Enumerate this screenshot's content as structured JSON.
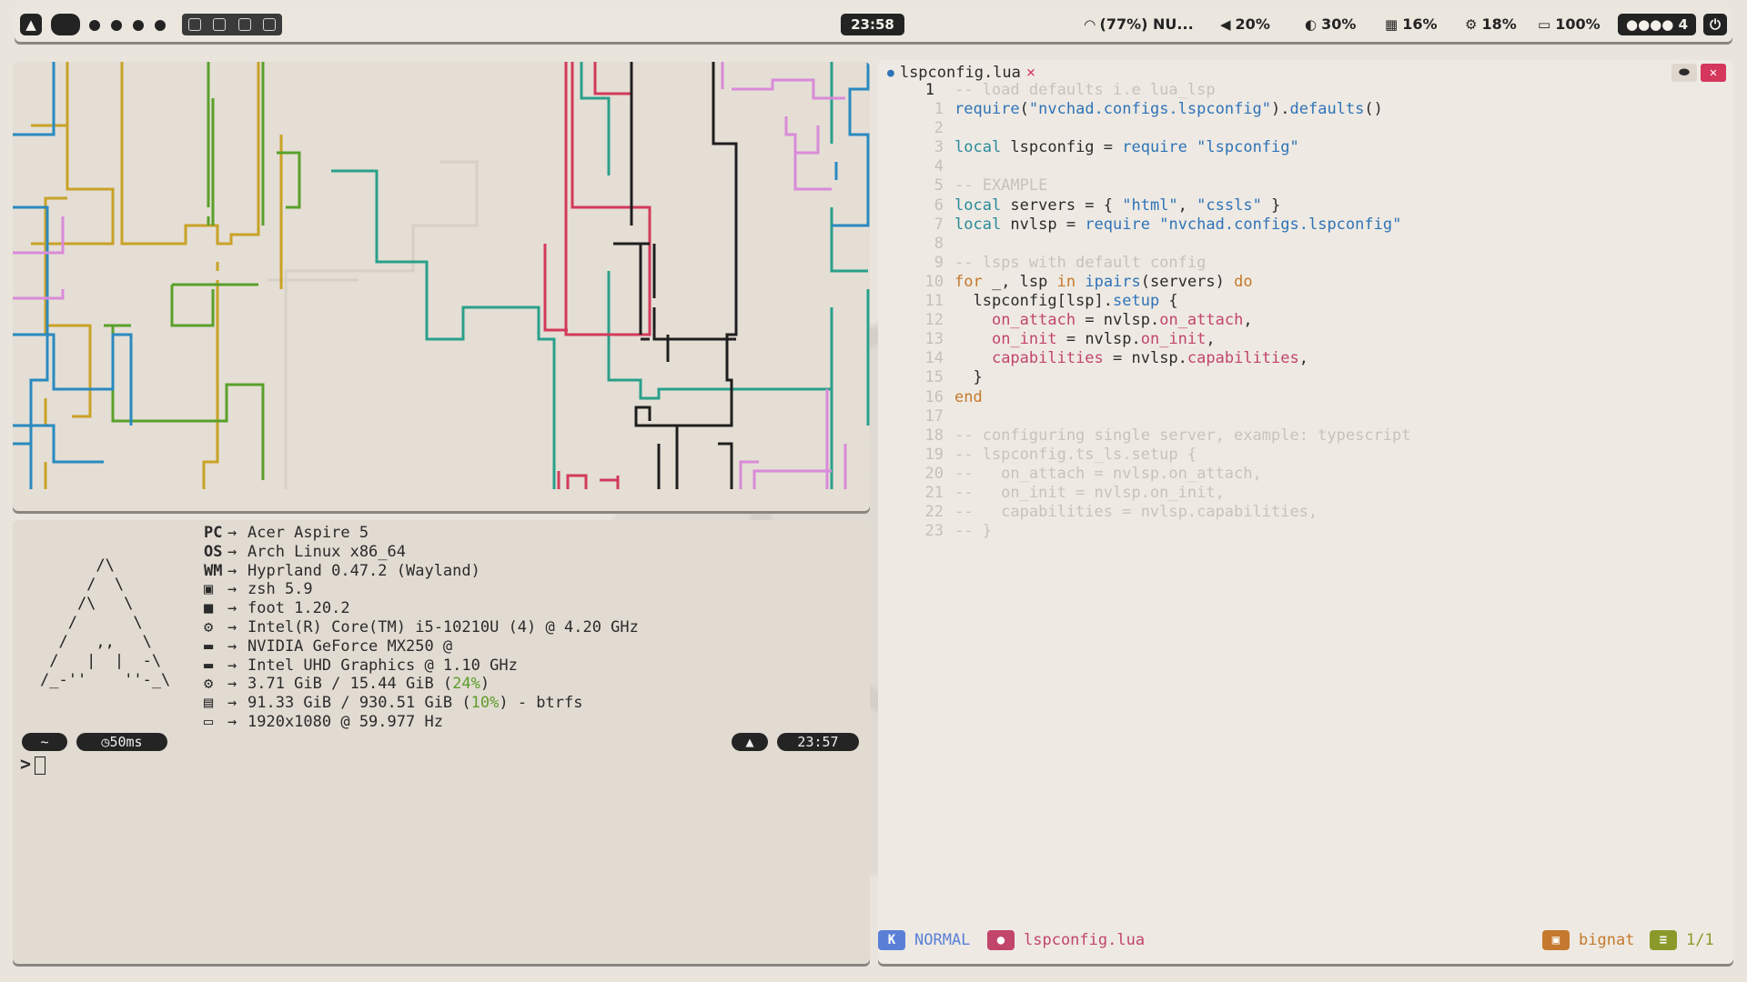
{
  "topbar": {
    "clock": "23:58",
    "wifi": "(77%) NU...",
    "volume": "20%",
    "brightness": "30%",
    "memory": "16%",
    "cpu": "18%",
    "battery": "100%",
    "notifications": "4",
    "icons": [
      "arch-logo",
      "wifi-icon",
      "volume-icon",
      "brightness-icon",
      "memory-icon",
      "cpu-icon",
      "battery-icon",
      "power-icon"
    ]
  },
  "fetch": {
    "logo": "      /\\\n     /  \\\n    /\\   \\\n   /      \\\n  /   ,,   \\\n /   |  |  -\\\n/_-''    ''-_\\",
    "rows": [
      {
        "key": "PC",
        "value": "Acer Aspire 5"
      },
      {
        "key": "OS",
        "value": "Arch Linux x86_64"
      },
      {
        "key": "WM",
        "value": "Hyprland 0.47.2 (Wayland)"
      },
      {
        "key": "",
        "value": "zsh 5.9"
      },
      {
        "key": "",
        "value": "foot 1.20.2"
      },
      {
        "key": "",
        "value": "Intel(R) Core(TM) i5-10210U (4) @ 4.20 GHz"
      },
      {
        "key": "",
        "value": "NVIDIA GeForce MX250 @"
      },
      {
        "key": "",
        "value": "Intel UHD Graphics @ 1.10 GHz"
      },
      {
        "key": "",
        "value_a": "3.71 GiB / 15.44 GiB (",
        "value_pct": "24%",
        "value_b": ")"
      },
      {
        "key": "",
        "value_a": "91.33 GiB / 930.51 GiB (",
        "value_pct": "10%",
        "value_b": ") - btrfs"
      },
      {
        "key": "",
        "value": "1920x1080 @ 59.977 Hz"
      }
    ],
    "arrow": "→",
    "prompt_dir": "~",
    "prompt_time": "50ms",
    "prompt_clock": "23:57",
    "prompt_symbol": ">"
  },
  "editor": {
    "filename": "lspconfig.lua",
    "close": "×",
    "status_mode": "NORMAL",
    "status_file": "lspconfig.lua",
    "status_branch": "bignat",
    "status_pos": "1/1",
    "lines": [
      {
        "n": "1",
        "cur": true,
        "parts": [
          [
            "cm",
            "-- load defaults i.e lua_lsp"
          ]
        ]
      },
      {
        "n": "1",
        "parts": [
          [
            "fn",
            "require"
          ],
          [
            "src",
            "("
          ],
          [
            "st",
            "\"nvchad.configs.lspconfig\""
          ],
          [
            "src",
            ")."
          ],
          [
            "fn",
            "defaults"
          ],
          [
            "src",
            "()"
          ]
        ]
      },
      {
        "n": "2",
        "parts": []
      },
      {
        "n": "3",
        "parts": [
          [
            "kw",
            "local"
          ],
          [
            "src",
            " lspconfig = "
          ],
          [
            "fn",
            "require"
          ],
          [
            "src",
            " "
          ],
          [
            "st",
            "\"lspconfig\""
          ]
        ]
      },
      {
        "n": "4",
        "parts": []
      },
      {
        "n": "5",
        "parts": [
          [
            "cm",
            "-- EXAMPLE"
          ]
        ]
      },
      {
        "n": "6",
        "parts": [
          [
            "kw",
            "local"
          ],
          [
            "src",
            " servers = { "
          ],
          [
            "st",
            "\"html\""
          ],
          [
            "src",
            ", "
          ],
          [
            "st",
            "\"cssls\""
          ],
          [
            "src",
            " }"
          ]
        ]
      },
      {
        "n": "7",
        "parts": [
          [
            "kw",
            "local"
          ],
          [
            "src",
            " nvlsp = "
          ],
          [
            "fn",
            "require"
          ],
          [
            "src",
            " "
          ],
          [
            "st",
            "\"nvchad.configs.lspconfig\""
          ]
        ]
      },
      {
        "n": "8",
        "parts": []
      },
      {
        "n": "9",
        "parts": [
          [
            "cm",
            "-- lsps with default config"
          ]
        ]
      },
      {
        "n": "10",
        "parts": [
          [
            "ctrl",
            "for"
          ],
          [
            "src",
            " _, lsp "
          ],
          [
            "ctrl",
            "in"
          ],
          [
            "src",
            " "
          ],
          [
            "fn",
            "ipairs"
          ],
          [
            "src",
            "(servers) "
          ],
          [
            "ctrl",
            "do"
          ]
        ]
      },
      {
        "n": "11",
        "parts": [
          [
            "src",
            "  lspconfig[lsp]."
          ],
          [
            "fn",
            "setup"
          ],
          [
            "src",
            " {"
          ]
        ]
      },
      {
        "n": "12",
        "parts": [
          [
            "src",
            "    "
          ],
          [
            "fld",
            "on_attach"
          ],
          [
            "src",
            " = nvlsp."
          ],
          [
            "fld",
            "on_attach"
          ],
          [
            "src",
            ","
          ]
        ]
      },
      {
        "n": "13",
        "parts": [
          [
            "src",
            "    "
          ],
          [
            "fld",
            "on_init"
          ],
          [
            "src",
            " = nvlsp."
          ],
          [
            "fld",
            "on_init"
          ],
          [
            "src",
            ","
          ]
        ]
      },
      {
        "n": "14",
        "parts": [
          [
            "src",
            "    "
          ],
          [
            "fld",
            "capabilities"
          ],
          [
            "src",
            " = nvlsp."
          ],
          [
            "fld",
            "capabilities"
          ],
          [
            "src",
            ","
          ]
        ]
      },
      {
        "n": "15",
        "parts": [
          [
            "src",
            "  }"
          ]
        ]
      },
      {
        "n": "16",
        "parts": [
          [
            "ctrl",
            "end"
          ]
        ]
      },
      {
        "n": "17",
        "parts": []
      },
      {
        "n": "18",
        "parts": [
          [
            "cm",
            "-- configuring single server, example: typescript"
          ]
        ]
      },
      {
        "n": "19",
        "parts": [
          [
            "cm",
            "-- lspconfig.ts_ls.setup {"
          ]
        ]
      },
      {
        "n": "20",
        "parts": [
          [
            "cm",
            "--   on_attach = nvlsp.on_attach,"
          ]
        ]
      },
      {
        "n": "21",
        "parts": [
          [
            "cm",
            "--   on_init = nvlsp.on_init,"
          ]
        ]
      },
      {
        "n": "22",
        "parts": [
          [
            "cm",
            "--   capabilities = nvlsp.capabilities,"
          ]
        ]
      },
      {
        "n": "23",
        "parts": [
          [
            "cm",
            "-- }"
          ]
        ]
      }
    ]
  }
}
